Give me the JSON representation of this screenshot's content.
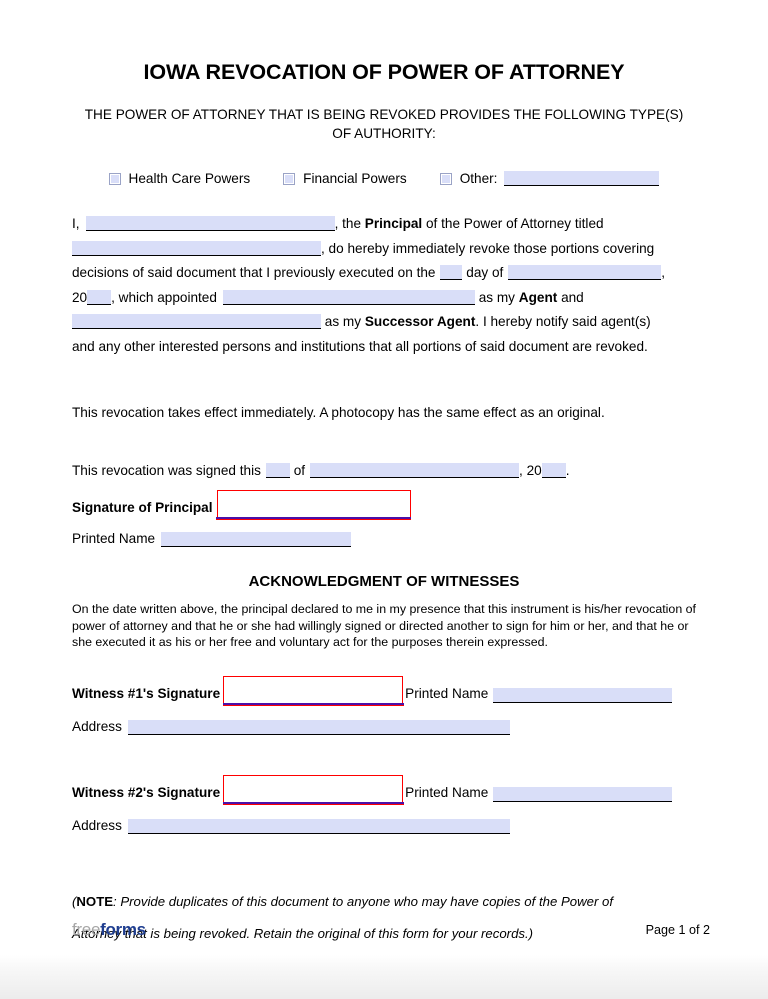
{
  "document": {
    "title": "IOWA REVOCATION OF POWER OF ATTORNEY",
    "subtitle": "THE POWER OF ATTORNEY THAT IS BEING REVOKED PROVIDES THE FOLLOWING TYPE(S) OF AUTHORITY:"
  },
  "authority_types": {
    "options": [
      {
        "label": "Health Care Powers",
        "checked": false
      },
      {
        "label": "Financial Powers",
        "checked": false
      },
      {
        "label": "Other:",
        "checked": false,
        "has_blank": true
      }
    ]
  },
  "body": {
    "line1_a": "I,",
    "line1_b": ", the",
    "line1_principal": "Principal",
    "line1_c": "of the Power of Attorney titled",
    "line2_b": ", do hereby immediately revoke those portions covering",
    "line3_a": "decisions of said document that I previously executed on the",
    "line3_b": "day of",
    "line3_c": ",",
    "line4_a": "20",
    "line4_b": ", which appointed",
    "line4_c": "as my",
    "line4_agent": "Agent",
    "line4_d": "and",
    "line5_b": "as my",
    "line5_successor": "Successor Agent",
    "line5_c": ". I hereby notify said agent(s)",
    "line6": "and any other interested persons and institutions that all portions of said document are revoked."
  },
  "effect_statement": "This revocation takes effect immediately. A photocopy has the same effect as an original.",
  "signed_line": {
    "prefix": "This revocation was signed this",
    "mid": "of",
    "year_prefix": ", 20",
    "suffix": "."
  },
  "principal": {
    "signature_label": "Signature of Principal",
    "printed_name_label": "Printed Name"
  },
  "witnesses": {
    "heading": "ACKNOWLEDGMENT OF WITNESSES",
    "acknowledgment_text": "On the date written above, the principal declared to me in my presence that this instrument is his/her revocation of power of attorney and that he or she had willingly signed or directed another to sign for him or her, and that he or she executed it as his or her free and voluntary act for the purposes therein expressed.",
    "entries": [
      {
        "signature_label": "Witness #1's Signature",
        "printed_name_label": "Printed Name",
        "address_label": "Address"
      },
      {
        "signature_label": "Witness #2's Signature",
        "printed_name_label": "Printed Name",
        "address_label": "Address"
      }
    ]
  },
  "note": {
    "open_paren": "(",
    "keyword": "NOTE",
    "text": ": Provide duplicates of this document to anyone who may have copies of the Power of",
    "line2": "Attorney that is being revoked. Retain the original of this form for your records.)"
  },
  "footer": {
    "logo_part1": "free",
    "logo_part2": "forms",
    "page_number": "Page 1 of 2"
  },
  "colors": {
    "field_fill": "#d9def8",
    "signature_border": "#ff0000",
    "signature_underline": "#4b11a8",
    "logo_blue": "#1f3e90",
    "logo_gray": "#a6a6a6"
  }
}
